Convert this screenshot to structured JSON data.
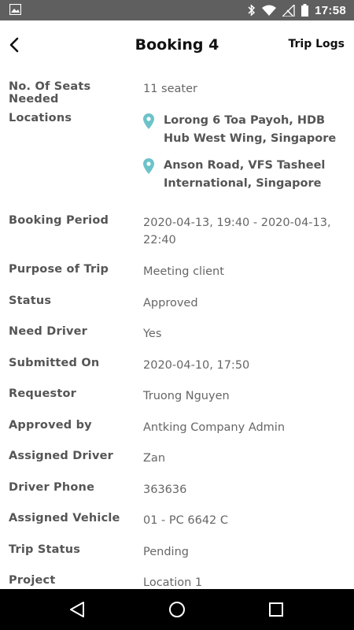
{
  "status_bar": {
    "time": "17:58",
    "icons": [
      "image-icon",
      "bluetooth-icon",
      "wifi-icon",
      "signal-off-icon",
      "battery-icon"
    ]
  },
  "header": {
    "title": "Booking 4",
    "back_icon": "back-arrow-icon",
    "action_label": "Trip Logs"
  },
  "details": {
    "seats": {
      "label": "No. Of Seats Needed",
      "value": "11 seater"
    },
    "locations": {
      "label": "Locations",
      "items": [
        {
          "icon": "location-pin-icon",
          "text": "Lorong 6 Toa Payoh, HDB Hub West Wing, Singapore"
        },
        {
          "icon": "location-pin-icon",
          "text": "Anson Road, VFS Tasheel International, Singapore"
        }
      ]
    },
    "booking_period": {
      "label": "Booking Period",
      "value": "2020-04-13, 19:40 - 2020-04-13, 22:40"
    },
    "purpose": {
      "label": "Purpose of Trip",
      "value": "Meeting client"
    },
    "status": {
      "label": "Status",
      "value": "Approved"
    },
    "need_driver": {
      "label": "Need Driver",
      "value": "Yes"
    },
    "submitted_on": {
      "label": "Submitted On",
      "value": "2020-04-10, 17:50"
    },
    "requestor": {
      "label": "Requestor",
      "value": "Truong Nguyen"
    },
    "approved_by": {
      "label": "Approved by",
      "value": "Antking Company Admin"
    },
    "assigned_driver": {
      "label": "Assigned Driver",
      "value": "Zan"
    },
    "driver_phone": {
      "label": "Driver Phone",
      "value": "363636"
    },
    "assigned_vehicle": {
      "label": "Assigned Vehicle",
      "value": "01 - PC 6642 C"
    },
    "trip_status": {
      "label": "Trip Status",
      "value": "Pending"
    },
    "project": {
      "label": "Project",
      "value": "Location 1"
    }
  },
  "colors": {
    "status_bar": "#5f5f5f",
    "pin": "#6cc3c9",
    "label": "#555555",
    "value": "#666666"
  },
  "nav_bar": {
    "buttons": [
      "back-triangle-icon",
      "home-circle-icon",
      "recents-square-icon"
    ]
  }
}
